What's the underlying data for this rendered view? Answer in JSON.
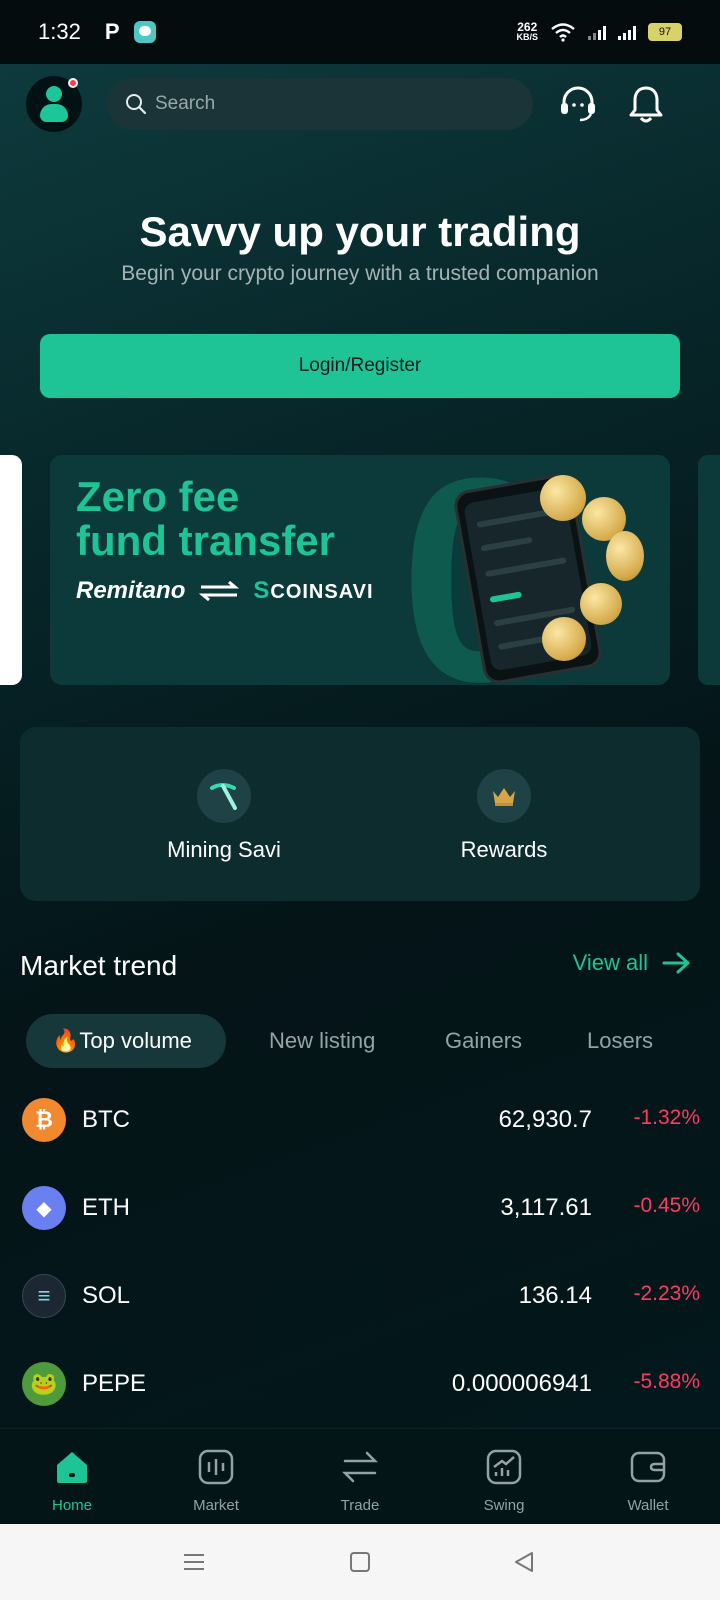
{
  "status_bar": {
    "time": "1:32",
    "app_badge": "P",
    "speed_value": "262",
    "speed_unit": "KB/S",
    "battery": "97"
  },
  "header": {
    "search_placeholder": "Search"
  },
  "hero": {
    "title": "Savvy up your trading",
    "subtitle": "Begin your crypto journey with a trusted companion",
    "login_label": "Login/Register"
  },
  "banner": {
    "headline_line1": "Zero fee",
    "headline_line2": "fund transfer",
    "brand_left": "Remitano",
    "brand_right": "COINSAVI",
    "big_glyph": "0"
  },
  "quick_actions": [
    {
      "label": "Mining Savi",
      "icon": "pickaxe-icon"
    },
    {
      "label": "Rewards",
      "icon": "crown-icon"
    }
  ],
  "market": {
    "title": "Market trend",
    "view_all": "View all",
    "tabs": [
      {
        "label": "Top volume",
        "active": true,
        "emoji": "🔥"
      },
      {
        "label": "New listing",
        "active": false
      },
      {
        "label": "Gainers",
        "active": false
      },
      {
        "label": "Losers",
        "active": false
      }
    ],
    "rows": [
      {
        "symbol": "BTC",
        "price": "62,930.7",
        "change": "-1.32%",
        "logo_color": "#f2892f",
        "logo_glyph": "₿"
      },
      {
        "symbol": "ETH",
        "price": "3,117.61",
        "change": "-0.45%",
        "logo_color": "#6a7ff0",
        "logo_glyph": "◆"
      },
      {
        "symbol": "SOL",
        "price": "136.14",
        "change": "-2.23%",
        "logo_color": "#1d2733",
        "logo_glyph": "≡"
      },
      {
        "symbol": "PEPE",
        "price": "0.000006941",
        "change": "-5.88%",
        "logo_color": "#4e9a3c",
        "logo_glyph": "🐸"
      }
    ]
  },
  "bottom_nav": [
    {
      "label": "Home",
      "active": true
    },
    {
      "label": "Market",
      "active": false
    },
    {
      "label": "Trade",
      "active": false
    },
    {
      "label": "Swing",
      "active": false
    },
    {
      "label": "Wallet",
      "active": false
    }
  ],
  "colors": {
    "accent": "#1ec495",
    "negative": "#ff3b5f",
    "background": "#03181c"
  }
}
